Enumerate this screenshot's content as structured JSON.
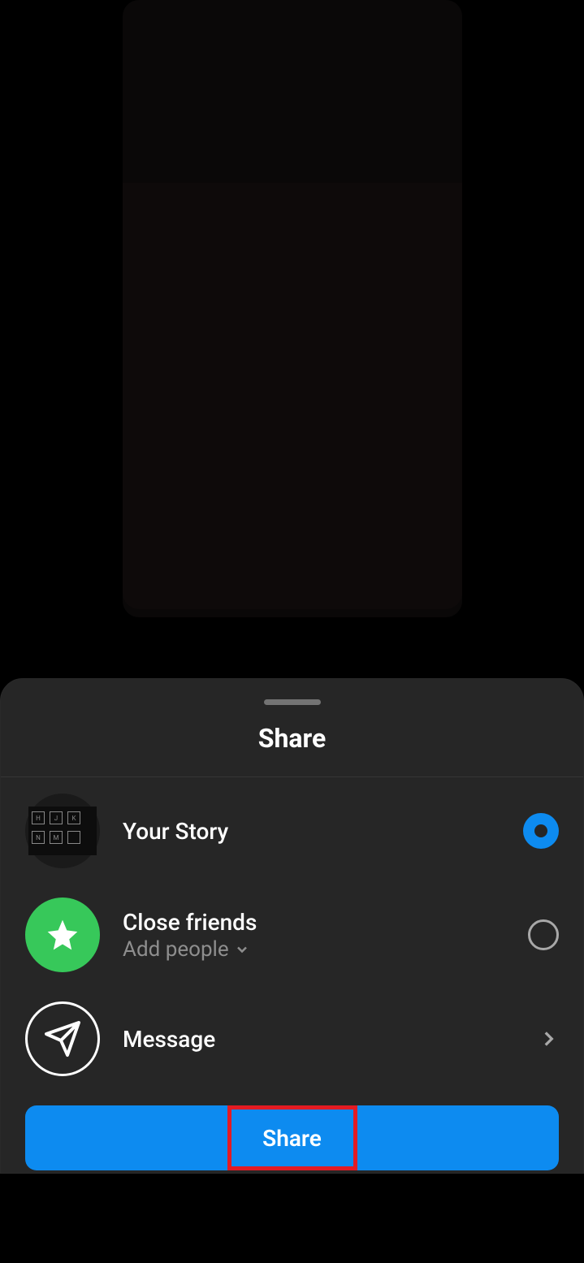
{
  "sheet": {
    "title": "Share",
    "options": [
      {
        "label": "Your Story",
        "sublabel": null,
        "selected": true
      },
      {
        "label": "Close friends",
        "sublabel": "Add people",
        "selected": false
      },
      {
        "label": "Message",
        "sublabel": null,
        "selected": null
      }
    ],
    "button_label": "Share"
  },
  "colors": {
    "accent": "#0d8bf0",
    "green": "#37c85a",
    "highlight_box": "#e31b23"
  }
}
